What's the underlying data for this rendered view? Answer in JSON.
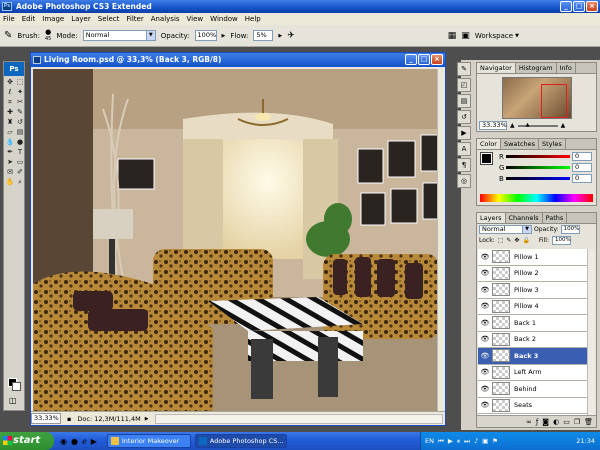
{
  "app": {
    "title": "Adobe Photoshop CS3 Extended",
    "logo": "Ps"
  },
  "menu": [
    "File",
    "Edit",
    "Image",
    "Layer",
    "Select",
    "Filter",
    "Analysis",
    "View",
    "Window",
    "Help"
  ],
  "options": {
    "brush_label": "Brush:",
    "brush_size": "45",
    "mode_label": "Mode:",
    "mode_value": "Normal",
    "opacity_label": "Opacity:",
    "opacity_value": "100%",
    "flow_label": "Flow:",
    "flow_value": "5%",
    "workspace_label": "Workspace"
  },
  "document": {
    "title": "Living Room.psd @ 33,3% (Back 3, RGB/8)",
    "zoom": "33,33%",
    "doc_info": "Doc: 12,3M/111,4M"
  },
  "navigator": {
    "tabs": [
      "Navigator",
      "Histogram",
      "Info"
    ],
    "zoom": "33.33%"
  },
  "color_panel": {
    "tabs": [
      "Color",
      "Swatches",
      "Styles"
    ],
    "channels": [
      {
        "label": "R",
        "value": "0"
      },
      {
        "label": "G",
        "value": "0"
      },
      {
        "label": "B",
        "value": "0"
      }
    ]
  },
  "layers_panel": {
    "tabs": [
      "Layers",
      "Channels",
      "Paths"
    ],
    "blend_mode": "Normal",
    "opacity_label": "Opacity:",
    "opacity_value": "100%",
    "lock_label": "Lock:",
    "fill_label": "Fill:",
    "fill_value": "100%",
    "layers": [
      {
        "name": "Pillow 1",
        "selected": false
      },
      {
        "name": "Pillow 2",
        "selected": false
      },
      {
        "name": "Pillow 3",
        "selected": false
      },
      {
        "name": "Pillow 4",
        "selected": false
      },
      {
        "name": "Back 1",
        "selected": false
      },
      {
        "name": "Back 2",
        "selected": false
      },
      {
        "name": "Back 3",
        "selected": true
      },
      {
        "name": "Left Arm",
        "selected": false
      },
      {
        "name": "Behind",
        "selected": false
      },
      {
        "name": "Seats",
        "selected": false
      }
    ]
  },
  "taskbar": {
    "start_label": "start",
    "windows": [
      {
        "label": "Interior Makeover",
        "active": false
      },
      {
        "label": "Adobe Photoshop CS...",
        "active": true
      }
    ],
    "language": "EN",
    "clock": "21:34"
  }
}
